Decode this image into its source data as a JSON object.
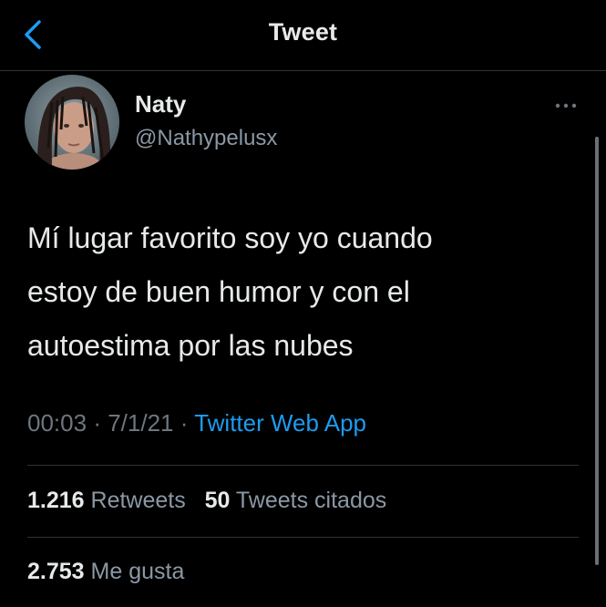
{
  "header": {
    "title": "Tweet",
    "back_icon": "chevron-left-icon",
    "accent_color": "#1d9bf0"
  },
  "author": {
    "name": "Naty",
    "handle": "@Nathypelusx",
    "avatar_icon": "profile-photo"
  },
  "tweet": {
    "lines": [
      "Mí lugar favorito soy yo cuando",
      "estoy de buen humor y con el",
      "autoestima por las nubes"
    ],
    "time": "00:03",
    "separator": "·",
    "date": "7/1/21",
    "source": "Twitter Web App"
  },
  "stats": {
    "retweets_count": "1.216",
    "retweets_label": "Retweets",
    "quotes_count": "50",
    "quotes_label": "Tweets citados",
    "likes_count": "2.753",
    "likes_label": "Me gusta"
  },
  "more_icon": "more-horizontal-icon"
}
